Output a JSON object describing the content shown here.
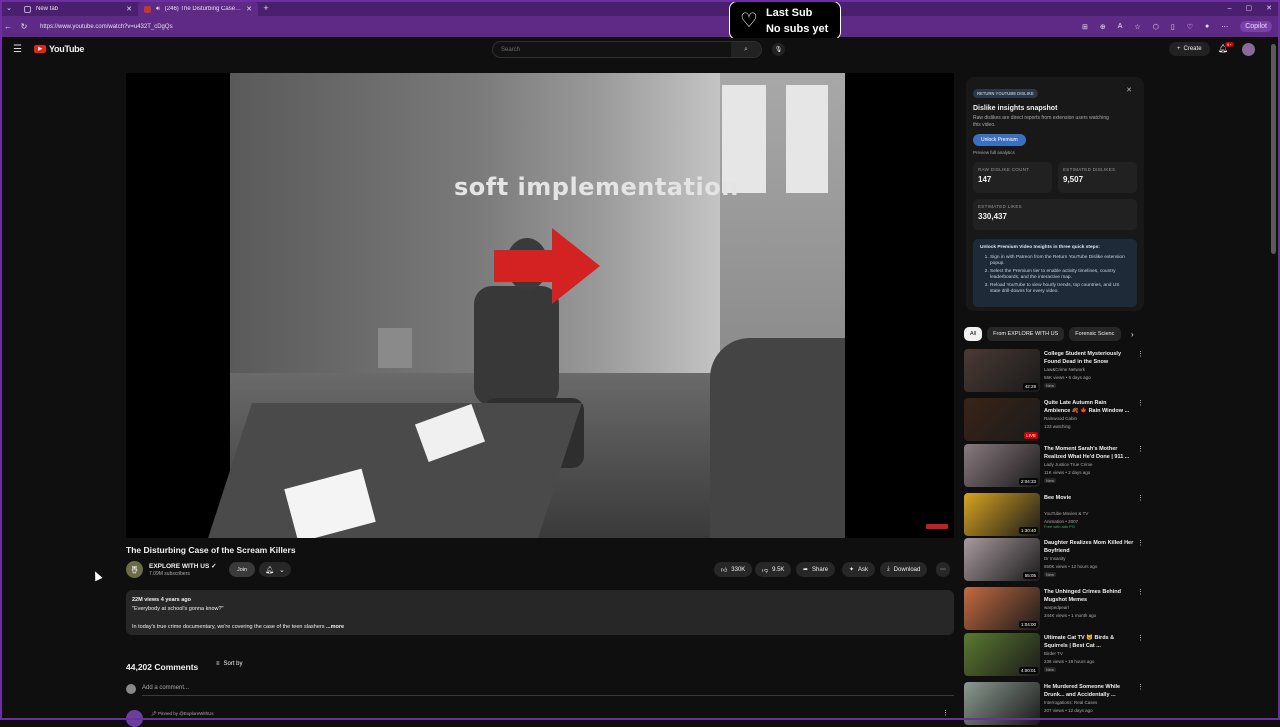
{
  "browser": {
    "tabs": [
      {
        "title": "New tab"
      },
      {
        "title": "(246) The Disturbing Case of t"
      }
    ],
    "url": "https://www.youtube.com/watch?v=u432T_cDgQs",
    "copilot_label": "Copilot"
  },
  "overlay": {
    "line1": "Last Sub",
    "line2": "No subs yet"
  },
  "header": {
    "logo_text": "YouTube",
    "search_placeholder": "Search",
    "create_label": "Create",
    "notif_count": "9+"
  },
  "video": {
    "overlay_text": "soft implementation",
    "title": "The Disturbing Case of the Scream Killers",
    "channel": "EXPLORE WITH US",
    "subscribers": "7.09M subscribers",
    "join_label": "Join",
    "likes": "330K",
    "dislikes": "9.5K",
    "share_label": "Share",
    "ask_label": "Ask",
    "download_label": "Download"
  },
  "description": {
    "meta": "22M views  4 years ago",
    "quote": "\"Everybody at school's gonna know?\"",
    "text": "In today's true crime documentary, we're covering the case of the teen slashers",
    "more": "...more"
  },
  "comments": {
    "count": "44,202 Comments",
    "sort_label": "Sort by",
    "add_placeholder": "Add a comment...",
    "pinned_by": "Pinned by @ExploreWithUs"
  },
  "dislike_panel": {
    "tag": "RETURN YOUTUBE DISLIKE",
    "title": "Dislike insights snapshot",
    "subtitle": "Raw dislikes are direct reports from extension users watching this video.",
    "unlock_label": "Unlock Premium",
    "preview_label": "Preview full analytics",
    "raw_label": "RAW DISLIKE COUNT",
    "raw_value": "147",
    "est_dislikes_label": "ESTIMATED DISLIKES",
    "est_dislikes_value": "9,507",
    "est_likes_label": "ESTIMATED LIKES",
    "est_likes_value": "330,437",
    "steps_title": "Unlock Premium Video Insights in three quick steps:",
    "steps": [
      "Sign in with Patreon from the Return YouTube Dislike extension popup.",
      "Select the Premium tier to enable activity timelines, country leaderboards, and the interactive map.",
      "Reload YouTube to view hourly trends, top countries, and US state drill-downs for every video."
    ]
  },
  "chips": [
    "All",
    "From EXPLORE WITH US",
    "Forensic Scienc"
  ],
  "recommended": [
    {
      "title": "College Student Mysteriously Found Dead in the Snow",
      "channel": "Law&Crime Network",
      "views": "56K views • 5 days ago",
      "badge": "New",
      "duration": "42:29",
      "thumb": "#4a3a34"
    },
    {
      "title": "Quite Late Autumn Rain Ambience 🍂 🍁 Rain Window ...",
      "channel": "Rainwood Cabin",
      "views": "133 watching",
      "badge": "",
      "duration": "LIVE",
      "thumb": "#3a2418"
    },
    {
      "title": "The Moment Sarah's Mother Realized What He'd Done | 911 ...",
      "channel": "Lady Justice True Crime",
      "views": "11K views • 2 days ago",
      "badge": "New",
      "duration": "2:04:33",
      "thumb": "#8a7a80"
    },
    {
      "title": "Bee Movie",
      "channel": "YouTube Movies & TV",
      "views": "Animation • 2007",
      "badge": "Free with ads  PG",
      "duration": "1:30:40",
      "thumb": "#d9a420"
    },
    {
      "title": "Daughter Realizes Mom Killed Her Boyfriend",
      "channel": "Dr Insanity",
      "views": "650K views • 12 hours ago",
      "badge": "New",
      "duration": "55:05",
      "thumb": "#a89aa0"
    },
    {
      "title": "The Unhinged Crimes Behind Mugshot Memes",
      "channel": "warpedpearl",
      "views": "344K views • 1 month ago",
      "badge": "",
      "duration": "1:04:00",
      "thumb": "#c46a40"
    },
    {
      "title": "Ultimate Cat TV 🐱 Birds & Squirrels | Best Cat ...",
      "channel": "Birder TV",
      "views": "236 views • 19 hours ago",
      "badge": "New",
      "duration": "4:00:01",
      "thumb": "#5a7a30"
    },
    {
      "title": "He Murdered Someone While Drunk... and Accidentally ...",
      "channel": "Interrogations: Real Cases",
      "views": "207 views • 12 days ago",
      "badge": "",
      "duration": "",
      "thumb": "#8a9a90"
    }
  ]
}
